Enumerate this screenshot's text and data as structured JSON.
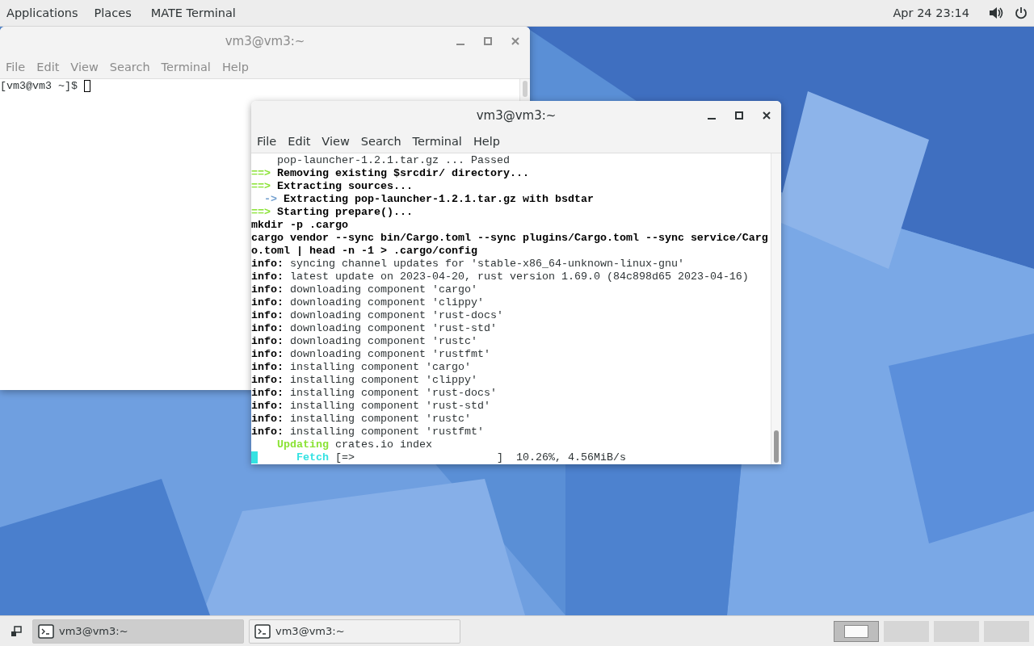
{
  "top_panel": {
    "menus": [
      "Applications",
      "Places",
      "MATE Terminal"
    ],
    "clock": "Apr 24  23:14"
  },
  "windows": [
    {
      "title": "vm3@vm3:~",
      "active": false,
      "menu": [
        "File",
        "Edit",
        "View",
        "Search",
        "Terminal",
        "Help"
      ],
      "lines": [
        {
          "segments": [
            {
              "text": "[vm3@vm3 ~]$ ",
              "kind": "plain"
            },
            {
              "kind": "cursor"
            }
          ]
        }
      ]
    },
    {
      "title": "vm3@vm3:~",
      "active": true,
      "menu": [
        "File",
        "Edit",
        "View",
        "Search",
        "Terminal",
        "Help"
      ],
      "lines": [
        {
          "segments": [
            {
              "text": "    pop-launcher-1.2.1.tar.gz ... Passed",
              "kind": "plain"
            }
          ]
        },
        {
          "segments": [
            {
              "text": "==>",
              "kind": "green"
            },
            {
              "text": " Removing existing $srcdir/ directory...",
              "kind": "bold"
            }
          ]
        },
        {
          "segments": [
            {
              "text": "==>",
              "kind": "green"
            },
            {
              "text": " Extracting sources...",
              "kind": "bold"
            }
          ]
        },
        {
          "segments": [
            {
              "text": "  ->",
              "kind": "blue"
            },
            {
              "text": " Extracting pop-launcher-1.2.1.tar.gz with bsdtar",
              "kind": "bold"
            }
          ]
        },
        {
          "segments": [
            {
              "text": "==>",
              "kind": "green"
            },
            {
              "text": " Starting prepare()...",
              "kind": "bold"
            }
          ]
        },
        {
          "segments": [
            {
              "text": "mkdir -p .cargo",
              "kind": "bold"
            }
          ]
        },
        {
          "segments": [
            {
              "text": "cargo vendor --sync bin/Cargo.toml --sync plugins/Cargo.toml --sync service/Carg",
              "kind": "bold"
            }
          ]
        },
        {
          "segments": [
            {
              "text": "o.toml | head -n -1 > .cargo/config",
              "kind": "bold"
            }
          ]
        },
        {
          "segments": [
            {
              "text": "info:",
              "kind": "bold"
            },
            {
              "text": " syncing channel updates for 'stable-x86_64-unknown-linux-gnu'",
              "kind": "plain"
            }
          ]
        },
        {
          "segments": [
            {
              "text": "info:",
              "kind": "bold"
            },
            {
              "text": " latest update on 2023-04-20, rust version 1.69.0 (84c898d65 2023-04-16)",
              "kind": "plain"
            }
          ]
        },
        {
          "segments": [
            {
              "text": "info:",
              "kind": "bold"
            },
            {
              "text": " downloading component 'cargo'",
              "kind": "plain"
            }
          ]
        },
        {
          "segments": [
            {
              "text": "info:",
              "kind": "bold"
            },
            {
              "text": " downloading component 'clippy'",
              "kind": "plain"
            }
          ]
        },
        {
          "segments": [
            {
              "text": "info:",
              "kind": "bold"
            },
            {
              "text": " downloading component 'rust-docs'",
              "kind": "plain"
            }
          ]
        },
        {
          "segments": [
            {
              "text": "info:",
              "kind": "bold"
            },
            {
              "text": " downloading component 'rust-std'",
              "kind": "plain"
            }
          ]
        },
        {
          "segments": [
            {
              "text": "info:",
              "kind": "bold"
            },
            {
              "text": " downloading component 'rustc'",
              "kind": "plain"
            }
          ]
        },
        {
          "segments": [
            {
              "text": "info:",
              "kind": "bold"
            },
            {
              "text": " downloading component 'rustfmt'",
              "kind": "plain"
            }
          ]
        },
        {
          "segments": [
            {
              "text": "info:",
              "kind": "bold"
            },
            {
              "text": " installing component 'cargo'",
              "kind": "plain"
            }
          ]
        },
        {
          "segments": [
            {
              "text": "info:",
              "kind": "bold"
            },
            {
              "text": " installing component 'clippy'",
              "kind": "plain"
            }
          ]
        },
        {
          "segments": [
            {
              "text": "info:",
              "kind": "bold"
            },
            {
              "text": " installing component 'rust-docs'",
              "kind": "plain"
            }
          ]
        },
        {
          "segments": [
            {
              "text": "info:",
              "kind": "bold"
            },
            {
              "text": " installing component 'rust-std'",
              "kind": "plain"
            }
          ]
        },
        {
          "segments": [
            {
              "text": "info:",
              "kind": "bold"
            },
            {
              "text": " installing component 'rustc'",
              "kind": "plain"
            }
          ]
        },
        {
          "segments": [
            {
              "text": "info:",
              "kind": "bold"
            },
            {
              "text": " installing component 'rustfmt'",
              "kind": "plain"
            }
          ]
        },
        {
          "segments": [
            {
              "text": "    Updating",
              "kind": "green"
            },
            {
              "text": " crates.io index",
              "kind": "plain"
            }
          ]
        },
        {
          "segments": [
            {
              "kind": "cursor"
            },
            {
              "text": "      Fetch",
              "kind": "cyan"
            },
            {
              "text": " [=>                      ]  10.26%, 4.56MiB/s",
              "kind": "plain"
            }
          ]
        }
      ]
    }
  ],
  "taskbar": [
    {
      "label": "vm3@vm3:~",
      "selected": true
    },
    {
      "label": "vm3@vm3:~",
      "selected": false
    }
  ],
  "workspaces": [
    {
      "selected": true
    },
    {
      "selected": false
    },
    {
      "selected": false
    },
    {
      "selected": false
    }
  ]
}
